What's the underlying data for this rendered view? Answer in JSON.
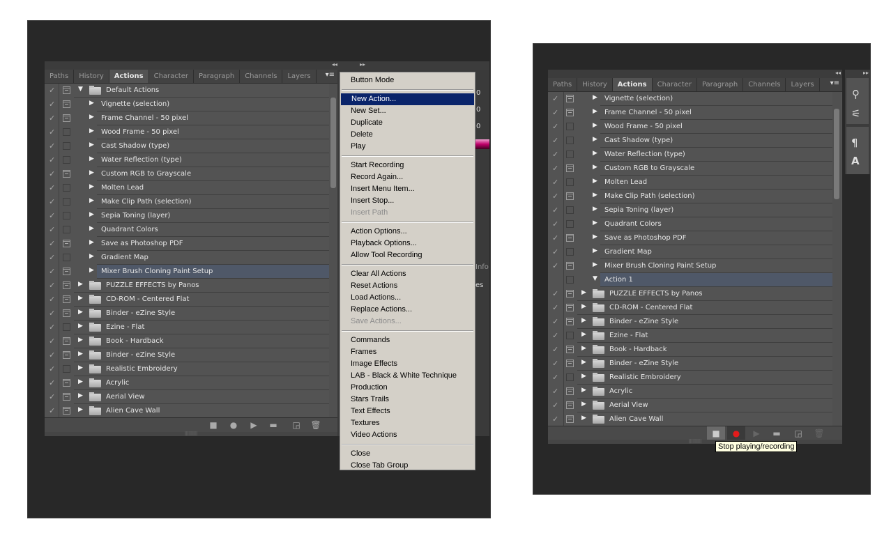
{
  "left": {
    "tabs": [
      "Paths",
      "History",
      "Actions",
      "Character",
      "Paragraph",
      "Channels",
      "Layers"
    ],
    "active_tab": "Actions",
    "rows": [
      {
        "label": "Default Actions",
        "type": "set",
        "expanded": true,
        "check": true,
        "dialog": true
      },
      {
        "label": "Vignette (selection)",
        "type": "action",
        "check": true,
        "dialog": true
      },
      {
        "label": "Frame Channel - 50 pixel",
        "type": "action",
        "check": true,
        "dialog": true
      },
      {
        "label": "Wood Frame - 50 pixel",
        "type": "action",
        "check": true,
        "dialog": false
      },
      {
        "label": "Cast Shadow (type)",
        "type": "action",
        "check": true,
        "dialog": false
      },
      {
        "label": "Water Reflection (type)",
        "type": "action",
        "check": true,
        "dialog": false
      },
      {
        "label": "Custom RGB to Grayscale",
        "type": "action",
        "check": true,
        "dialog": true
      },
      {
        "label": "Molten Lead",
        "type": "action",
        "check": true,
        "dialog": false
      },
      {
        "label": "Make Clip Path (selection)",
        "type": "action",
        "check": true,
        "dialog": false
      },
      {
        "label": "Sepia Toning (layer)",
        "type": "action",
        "check": true,
        "dialog": false
      },
      {
        "label": "Quadrant Colors",
        "type": "action",
        "check": true,
        "dialog": false
      },
      {
        "label": "Save as Photoshop PDF",
        "type": "action",
        "check": true,
        "dialog": true
      },
      {
        "label": "Gradient Map",
        "type": "action",
        "check": true,
        "dialog": false
      },
      {
        "label": "Mixer Brush Cloning Paint Setup",
        "type": "action",
        "check": true,
        "dialog": true,
        "selected": true
      },
      {
        "label": "PUZZLE EFFECTS by Panos",
        "type": "set",
        "check": true,
        "dialog": true
      },
      {
        "label": "CD-ROM - Centered Flat",
        "type": "set",
        "check": true,
        "dialog": true
      },
      {
        "label": "Binder - eZine Style",
        "type": "set",
        "check": true,
        "dialog": true
      },
      {
        "label": "Ezine - Flat",
        "type": "set",
        "check": true,
        "dialog": false
      },
      {
        "label": "Book - Hardback",
        "type": "set",
        "check": true,
        "dialog": true
      },
      {
        "label": "Binder - eZine Style",
        "type": "set",
        "check": true,
        "dialog": true
      },
      {
        "label": "Realistic Embroidery",
        "type": "set",
        "check": true,
        "dialog": false
      },
      {
        "label": "Acrylic",
        "type": "set",
        "check": true,
        "dialog": true
      },
      {
        "label": "Aerial View",
        "type": "set",
        "check": true,
        "dialog": true
      },
      {
        "label": "Alien Cave Wall",
        "type": "set",
        "check": true,
        "dialog": true
      }
    ],
    "side_values": [
      "0",
      "0",
      "0"
    ],
    "side_tab": "Info",
    "side_text": "es"
  },
  "menu": {
    "groups": [
      [
        {
          "label": "Button Mode"
        }
      ],
      [
        {
          "label": "New Action...",
          "highlighted": true
        },
        {
          "label": "New Set..."
        },
        {
          "label": "Duplicate"
        },
        {
          "label": "Delete"
        },
        {
          "label": "Play"
        }
      ],
      [
        {
          "label": "Start Recording"
        },
        {
          "label": "Record Again..."
        },
        {
          "label": "Insert Menu Item..."
        },
        {
          "label": "Insert Stop..."
        },
        {
          "label": "Insert Path",
          "disabled": true
        }
      ],
      [
        {
          "label": "Action Options..."
        },
        {
          "label": "Playback Options..."
        },
        {
          "label": "Allow Tool Recording"
        }
      ],
      [
        {
          "label": "Clear All Actions"
        },
        {
          "label": "Reset Actions"
        },
        {
          "label": "Load Actions..."
        },
        {
          "label": "Replace Actions..."
        },
        {
          "label": "Save Actions...",
          "disabled": true
        }
      ],
      [
        {
          "label": "Commands"
        },
        {
          "label": "Frames"
        },
        {
          "label": "Image Effects"
        },
        {
          "label": "LAB - Black & White Technique"
        },
        {
          "label": "Production"
        },
        {
          "label": "Stars Trails"
        },
        {
          "label": "Text Effects"
        },
        {
          "label": "Textures"
        },
        {
          "label": "Video Actions"
        }
      ],
      [
        {
          "label": "Close"
        },
        {
          "label": "Close Tab Group"
        }
      ]
    ]
  },
  "right": {
    "tabs": [
      "Paths",
      "History",
      "Actions",
      "Character",
      "Paragraph",
      "Channels",
      "Layers"
    ],
    "active_tab": "Actions",
    "rows": [
      {
        "label": "Vignette (selection)",
        "type": "action",
        "check": true,
        "dialog": true
      },
      {
        "label": "Frame Channel - 50 pixel",
        "type": "action",
        "check": true,
        "dialog": true
      },
      {
        "label": "Wood Frame - 50 pixel",
        "type": "action",
        "check": true,
        "dialog": false
      },
      {
        "label": "Cast Shadow (type)",
        "type": "action",
        "check": true,
        "dialog": false
      },
      {
        "label": "Water Reflection (type)",
        "type": "action",
        "check": true,
        "dialog": false
      },
      {
        "label": "Custom RGB to Grayscale",
        "type": "action",
        "check": true,
        "dialog": true
      },
      {
        "label": "Molten Lead",
        "type": "action",
        "check": true,
        "dialog": false
      },
      {
        "label": "Make Clip Path (selection)",
        "type": "action",
        "check": true,
        "dialog": true
      },
      {
        "label": "Sepia Toning (layer)",
        "type": "action",
        "check": true,
        "dialog": false
      },
      {
        "label": "Quadrant Colors",
        "type": "action",
        "check": true,
        "dialog": false
      },
      {
        "label": "Save as Photoshop PDF",
        "type": "action",
        "check": true,
        "dialog": true
      },
      {
        "label": "Gradient Map",
        "type": "action",
        "check": true,
        "dialog": false
      },
      {
        "label": "Mixer Brush Cloning Paint Setup",
        "type": "action",
        "check": true,
        "dialog": true
      },
      {
        "label": "Action 1",
        "type": "action",
        "expanded": true,
        "check": false,
        "dialog": false,
        "selected": true
      },
      {
        "label": "PUZZLE EFFECTS by Panos",
        "type": "set",
        "check": true,
        "dialog": true
      },
      {
        "label": "CD-ROM - Centered Flat",
        "type": "set",
        "check": true,
        "dialog": true
      },
      {
        "label": "Binder - eZine Style",
        "type": "set",
        "check": true,
        "dialog": true
      },
      {
        "label": "Ezine - Flat",
        "type": "set",
        "check": true,
        "dialog": false
      },
      {
        "label": "Book - Hardback",
        "type": "set",
        "check": true,
        "dialog": true
      },
      {
        "label": "Binder - eZine Style",
        "type": "set",
        "check": true,
        "dialog": true
      },
      {
        "label": "Realistic Embroidery",
        "type": "set",
        "check": true,
        "dialog": false
      },
      {
        "label": "Acrylic",
        "type": "set",
        "check": true,
        "dialog": true
      },
      {
        "label": "Aerial View",
        "type": "set",
        "check": true,
        "dialog": true
      },
      {
        "label": "Alien Cave Wall",
        "type": "set",
        "check": true,
        "dialog": true
      }
    ],
    "recording": true,
    "record_color": "#e31b1b",
    "tooltip": "Stop playing/recording",
    "tool_icons": [
      "brush-presets-icon",
      "tool-presets-icon",
      "paragraph-styles-icon",
      "character-styles-icon"
    ]
  }
}
